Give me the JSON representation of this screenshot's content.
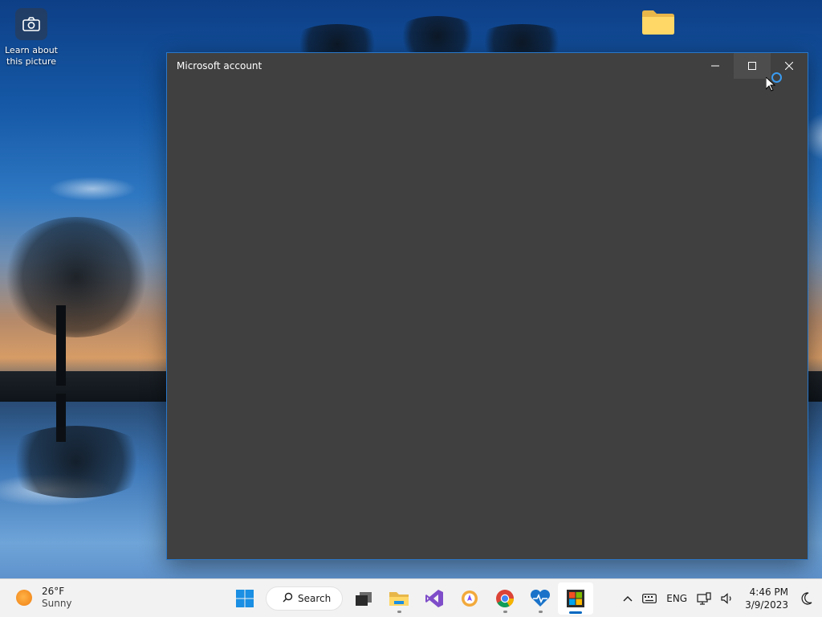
{
  "desktop": {
    "icons": [
      {
        "label": "Learn about this picture",
        "icon": "camera-icon"
      },
      {
        "label": "",
        "icon": "folder-icon"
      }
    ]
  },
  "window": {
    "title": "Microsoft account",
    "controls": {
      "minimize": "minimize-icon",
      "maximize": "maximize-icon",
      "close": "close-icon"
    },
    "accent": "#2a78c9",
    "background": "#404040"
  },
  "taskbar": {
    "weather": {
      "temp": "26°F",
      "condition": "Sunny"
    },
    "search_label": "Search",
    "apps": [
      "windows-start-icon",
      "task-view-icon",
      "file-explorer-icon",
      "visual-studio-icon",
      "brave-icon",
      "chrome-icon",
      "health-icon",
      "microsoft-store-icon"
    ],
    "tray": {
      "language": "ENG",
      "time": "4:46 PM",
      "date": "3/9/2023"
    }
  }
}
